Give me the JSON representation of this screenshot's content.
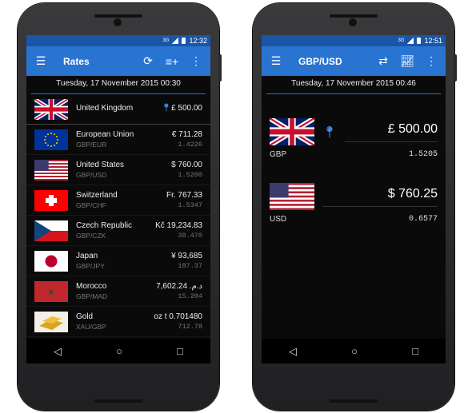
{
  "left": {
    "status_time": "12:32",
    "network": "3G",
    "title": "Rates",
    "icons": [
      "menu-icon",
      "refresh-icon",
      "add-list-icon",
      "more-vert-icon"
    ],
    "date": "Tuesday, 17 November 2015 00:30",
    "rows": [
      {
        "name": "United Kingdom",
        "code": "",
        "value": "£ 500.00",
        "rate": "",
        "flag": "uk",
        "pinned": true
      },
      {
        "name": "European Union",
        "code": "GBP/EUR",
        "value": "€ 711.28",
        "rate": "1.4226",
        "flag": "eu"
      },
      {
        "name": "United States",
        "code": "GBP/USD",
        "value": "$ 760.00",
        "rate": "1.5200",
        "flag": "us"
      },
      {
        "name": "Switzerland",
        "code": "GBP/CHF",
        "value": "Fr. 767.33",
        "rate": "1.5347",
        "flag": "ch"
      },
      {
        "name": "Czech Republic",
        "code": "GBP/CZK",
        "value": "Kč 19,234.83",
        "rate": "38.470",
        "flag": "cz"
      },
      {
        "name": "Japan",
        "code": "GBP/JPY",
        "value": "¥ 93,685",
        "rate": "187.37",
        "flag": "jp"
      },
      {
        "name": "Morocco",
        "code": "GBP/MAD",
        "value": "د.م. 7,602.24",
        "rate": "15.204",
        "flag": "ma"
      },
      {
        "name": "Gold",
        "code": "XAU/GBP",
        "value": "oz t 0.701480",
        "rate": "712.78",
        "flag": "gold"
      }
    ]
  },
  "right": {
    "status_time": "12:51",
    "network": "3G",
    "title": "GBP/USD",
    "icons": [
      "menu-icon",
      "swap-icon",
      "chart-icon",
      "more-vert-icon"
    ],
    "date": "Tuesday, 17 November 2015 00:46",
    "from": {
      "amount": "£ 500.00",
      "code": "GBP",
      "rate": "1.5205",
      "flag": "uk"
    },
    "to": {
      "amount": "$ 760.25",
      "code": "USD",
      "rate": "0.6577",
      "flag": "us"
    }
  },
  "nav": {
    "back": "◁",
    "home": "○",
    "recents": "□"
  },
  "colors": {
    "status": "#1a56a8",
    "appbar": "#2a74d1",
    "pin": "#3a8ae8"
  }
}
